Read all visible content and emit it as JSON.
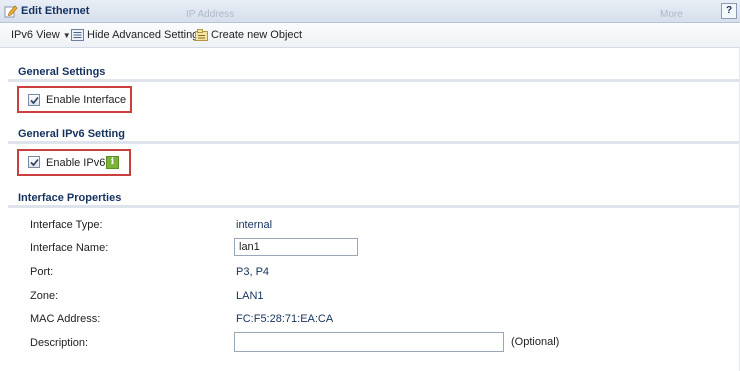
{
  "window": {
    "title": "Edit Ethernet",
    "ghost_left": "IP Address",
    "ghost_right": "More",
    "help": "?"
  },
  "toolbar": {
    "view_label": "IPv6 View",
    "hide_advanced_label": "Hide Advanced Settings",
    "create_object_label": "Create new Object"
  },
  "general_settings": {
    "title": "General Settings",
    "enable_interface_label": "Enable Interface",
    "enable_interface_checked": true
  },
  "general_ipv6": {
    "title": "General IPv6 Setting",
    "enable_ipv6_label": "Enable IPv6",
    "enable_ipv6_checked": true,
    "info_glyph": "i"
  },
  "interface_properties": {
    "title": "Interface Properties",
    "type_label": "Interface Type:",
    "type_value": "internal",
    "name_label": "Interface Name:",
    "name_value": "lan1",
    "port_label": "Port:",
    "port_value": "P3, P4",
    "zone_label": "Zone:",
    "zone_value": "LAN1",
    "mac_label": "MAC Address:",
    "mac_value": "FC:F5:28:71:EA:CA",
    "description_label": "Description:",
    "description_value": "",
    "optional_label": "(Optional)"
  },
  "colors": {
    "accent": "#15325f",
    "highlight": "#c9403f",
    "info_icon": "#7ab33b"
  },
  "icons": [
    "edit-icon",
    "help-icon",
    "dropdown-caret-icon",
    "settings-list-icon",
    "create-object-icon",
    "checkbox-checked-icon",
    "info-icon"
  ]
}
